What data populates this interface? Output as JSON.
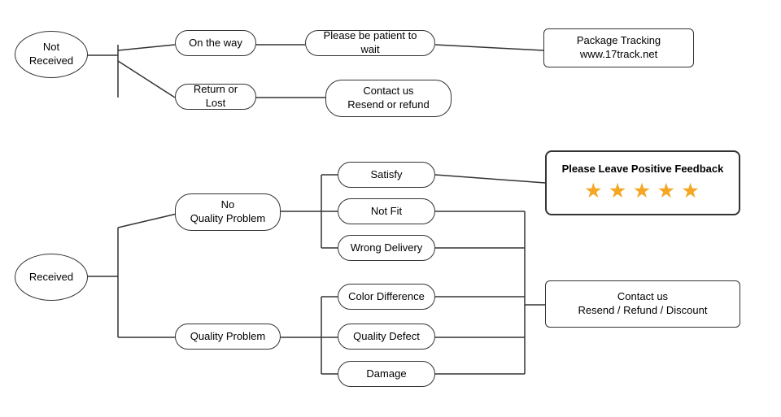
{
  "nodes": {
    "not_received": {
      "label": "Not\nReceived"
    },
    "on_the_way": {
      "label": "On the way"
    },
    "return_or_lost": {
      "label": "Return or Lost"
    },
    "be_patient": {
      "label": "Please be patient to wait"
    },
    "contact_resend": {
      "label": "Contact us\nResend or refund"
    },
    "package_tracking": {
      "label": "Package Tracking\nwww.17track.net"
    },
    "received": {
      "label": "Received"
    },
    "no_quality_problem": {
      "label": "No\nQuality Problem"
    },
    "quality_problem": {
      "label": "Quality Problem"
    },
    "satisfy": {
      "label": "Satisfy"
    },
    "not_fit": {
      "label": "Not Fit"
    },
    "wrong_delivery": {
      "label": "Wrong Delivery"
    },
    "color_difference": {
      "label": "Color Difference"
    },
    "quality_defect": {
      "label": "Quality Defect"
    },
    "damage": {
      "label": "Damage"
    },
    "positive_feedback": {
      "label": "Please Leave Positive Feedback"
    },
    "stars": {
      "label": "★ ★ ★ ★ ★"
    },
    "contact_refund": {
      "label": "Contact us\nResend / Refund / Discount"
    }
  }
}
